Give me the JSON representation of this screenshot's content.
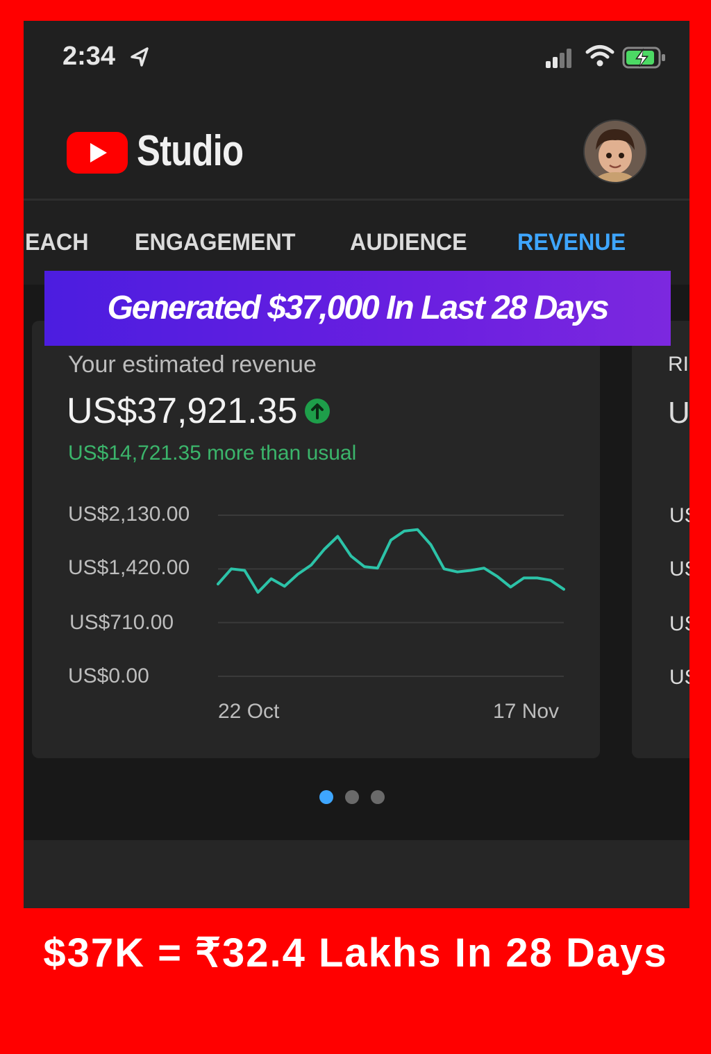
{
  "status_bar": {
    "time": "2:34"
  },
  "header": {
    "app_name": "Studio"
  },
  "tabs": [
    {
      "label": "EACH"
    },
    {
      "label": "ENGAGEMENT"
    },
    {
      "label": "AUDIENCE"
    },
    {
      "label": "REVENUE",
      "active": true
    }
  ],
  "banner": {
    "text": "Generated $37,000 In Last 28 Days"
  },
  "revenue_card": {
    "label": "Your estimated revenue",
    "value": "US$37,921.35",
    "delta_text": "US$14,721.35 more than usual"
  },
  "chart_data": {
    "type": "line",
    "y_ticks": [
      "US$2,130.00",
      "US$1,420.00",
      "US$710.00",
      "US$0.00"
    ],
    "ylim": [
      0,
      2130
    ],
    "x_labels": [
      "22 Oct",
      "17 Nov"
    ],
    "series": [
      {
        "values": [
          1220,
          1420,
          1400,
          1110,
          1290,
          1190,
          1350,
          1470,
          1680,
          1850,
          1590,
          1450,
          1430,
          1800,
          1920,
          1940,
          1740,
          1420,
          1380,
          1400,
          1430,
          1320,
          1180,
          1300,
          1300,
          1270,
          1150
        ]
      }
    ],
    "colors": {
      "line": "#2cc3a8",
      "grid": "#3a3a3a"
    }
  },
  "peek_card": {
    "title_partial": "RI",
    "value_partial": "U",
    "ticks_partial": [
      "US",
      "US",
      "US",
      "US"
    ]
  },
  "pagination": {
    "count": 3,
    "active_index": 0
  },
  "caption": {
    "text": "$37K = ₹32.4 Lakhs In 28 Days"
  }
}
